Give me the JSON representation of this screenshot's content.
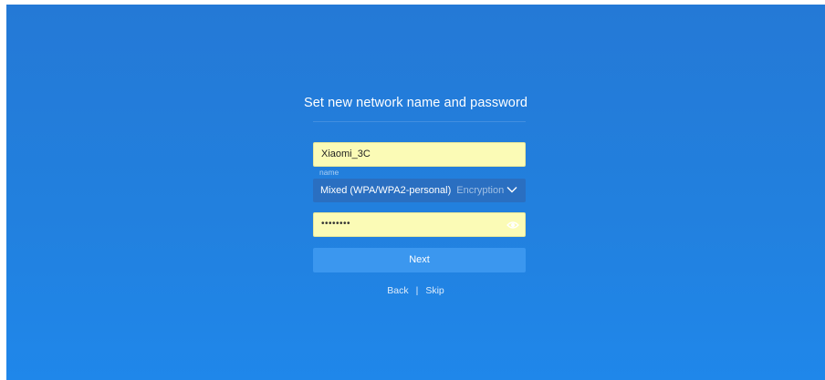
{
  "setup": {
    "title": "Set new network name and password",
    "network_name": {
      "value": "Xiaomi_3C",
      "caption": "name"
    },
    "encryption": {
      "selected": "Mixed (WPA/WPA2-personal)",
      "label": "Encryption",
      "chevron_icon": "chevron-down-icon"
    },
    "password": {
      "masked_value": "••••••••",
      "toggle_icon": "eye-icon"
    },
    "next_label": "Next",
    "back_label": "Back",
    "separator": "|",
    "skip_label": "Skip"
  },
  "colors": {
    "background": "#2280de",
    "input_fill": "#fbfbb6",
    "select_fill": "#2a6fc1",
    "button": "#3b97ef"
  }
}
